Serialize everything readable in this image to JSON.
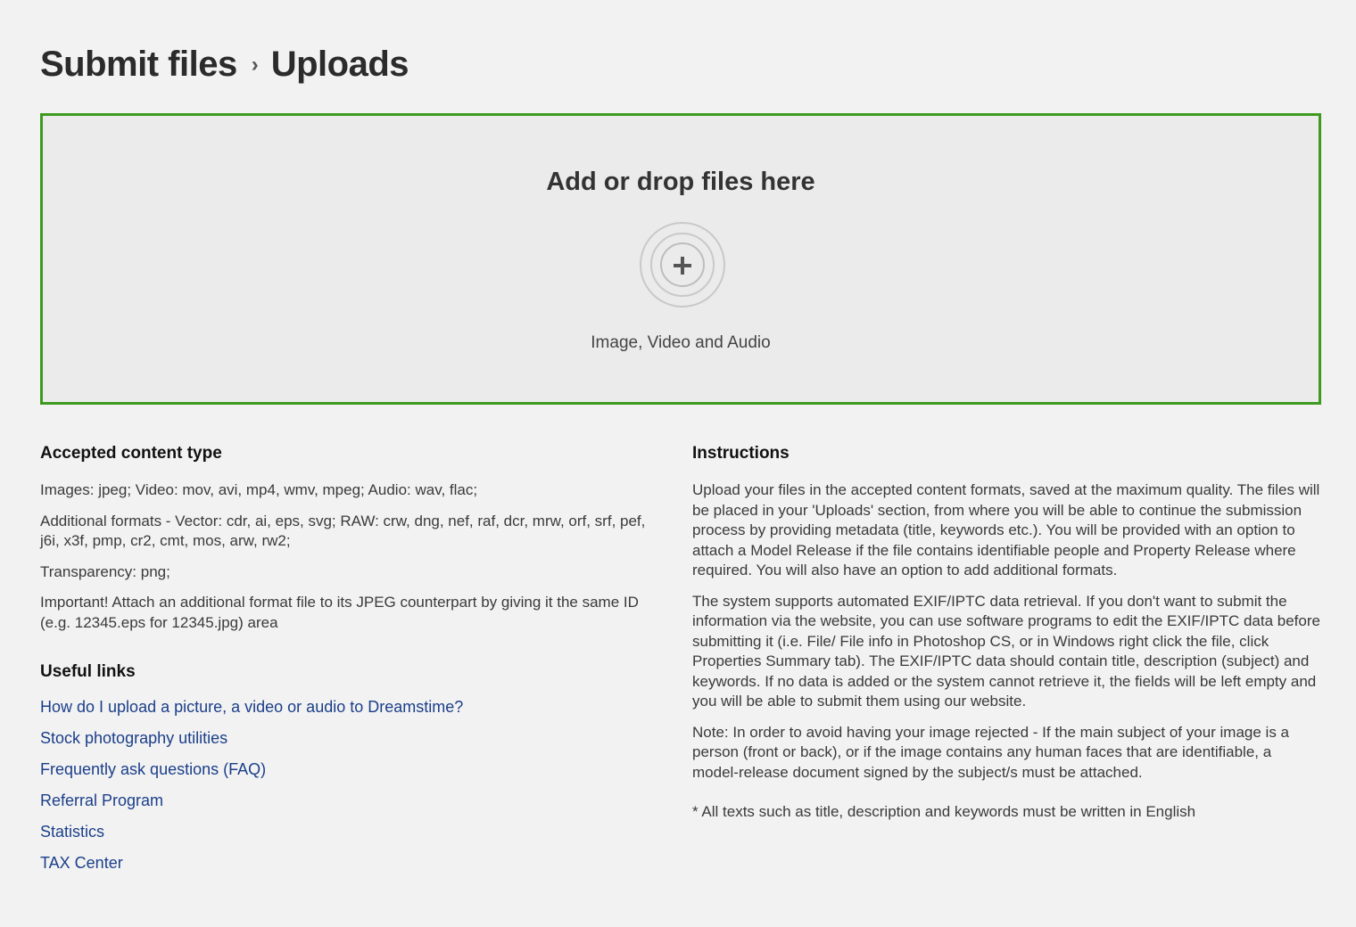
{
  "header": {
    "title": "Submit files",
    "separator": "›",
    "subtitle": "Uploads"
  },
  "dropzone": {
    "heading": "Add or drop files here",
    "icon": "add-circle-icon",
    "caption": "Image, Video and Audio",
    "border_color": "#3d9a1e"
  },
  "accepted": {
    "heading": "Accepted content type",
    "paragraphs": [
      "Images: jpeg; Video: mov, avi, mp4, wmv, mpeg; Audio: wav, flac;",
      "Additional formats - Vector: cdr, ai, eps, svg; RAW: crw, dng, nef, raf, dcr, mrw, orf, srf, pef, j6i, x3f, pmp, cr2, cmt, mos, arw, rw2;",
      "Transparency: png;",
      "Important! Attach an additional format file to its JPEG counterpart by giving it the same ID (e.g. 12345.eps for 12345.jpg) area"
    ]
  },
  "useful_links": {
    "heading": "Useful links",
    "items": [
      "How do I upload a picture, a video or audio to Dreamstime?",
      "Stock photography utilities",
      "Frequently ask questions (FAQ)",
      "Referral Program",
      "Statistics",
      "TAX Center"
    ]
  },
  "instructions": {
    "heading": "Instructions",
    "paragraphs": [
      "Upload your files in the accepted content formats, saved at the maximum quality. The files will be placed in your 'Uploads' section, from where you will be able to continue the submission process by providing metadata (title, keywords etc.). You will be provided with an option to attach a Model Release if the file contains identifiable people and Property Release where required. You will also have an option to add additional formats.",
      "The system supports automated EXIF/IPTC data retrieval. If you don't want to submit the information via the website, you can use software programs to edit the EXIF/IPTC data before submitting it (i.e. File/ File info in Photoshop CS, or in Windows right click the file, click Properties Summary tab). The EXIF/IPTC data should contain title, description (subject) and keywords. If no data is added or the system cannot retrieve it, the fields will be left empty and you will be able to submit them using our website.",
      "Note: In order to avoid having your image rejected - If the main subject of your image is a person (front or back), or if the image contains any human faces that are identifiable, a model-release document signed by the subject/s must be attached."
    ],
    "footnote": "* All texts such as title, description and keywords must be written in English"
  },
  "colors": {
    "background": "#f2f2f2",
    "link": "#1b3f8a",
    "accent_green": "#3d9a1e"
  }
}
